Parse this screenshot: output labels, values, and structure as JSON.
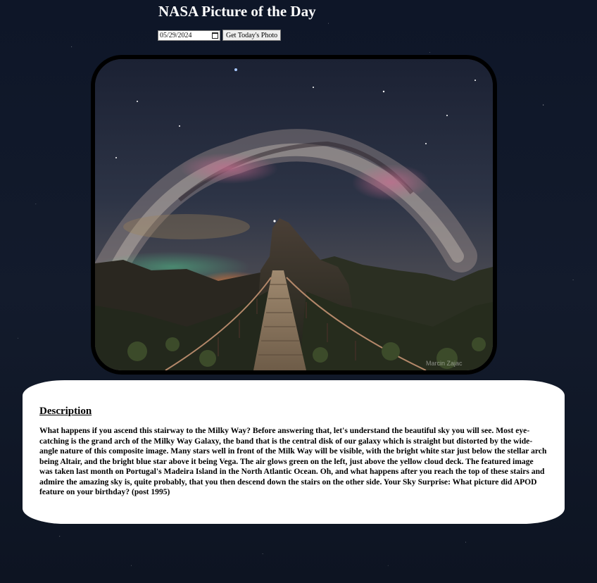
{
  "header": {
    "title": "NASA Picture of the Day"
  },
  "controls": {
    "date_value": "05/29/2024",
    "button_label": "Get Today's Photo"
  },
  "photo": {
    "watermark": "Marcin Zajac"
  },
  "description": {
    "heading": "Description",
    "text": "What happens if you ascend this stairway to the Milky Way? Before answering that, let's understand the beautiful sky you will see. Most eye-catching is the grand arch of the Milky Way Galaxy, the band that is the central disk of our galaxy which is straight but distorted by the wide-angle nature of this composite image. Many stars well in front of the Milk Way will be visible, with the bright white star just below the stellar arch being Altair, and the bright blue star above it being Vega. The air glows green on the left, just above the yellow cloud deck. The featured image was taken last month on Portugal's Madeira Island in the North Atlantic Ocean. Oh, and what happens after you reach the top of these stairs and admire the amazing sky is, quite probably, that you then descend down the stairs on the other side. Your Sky Surprise: What picture did APOD feature on your birthday? (post 1995)"
  },
  "colors": {
    "page_background": "#0b1220",
    "card_background": "#ffffff",
    "title_color": "#ffffff"
  }
}
